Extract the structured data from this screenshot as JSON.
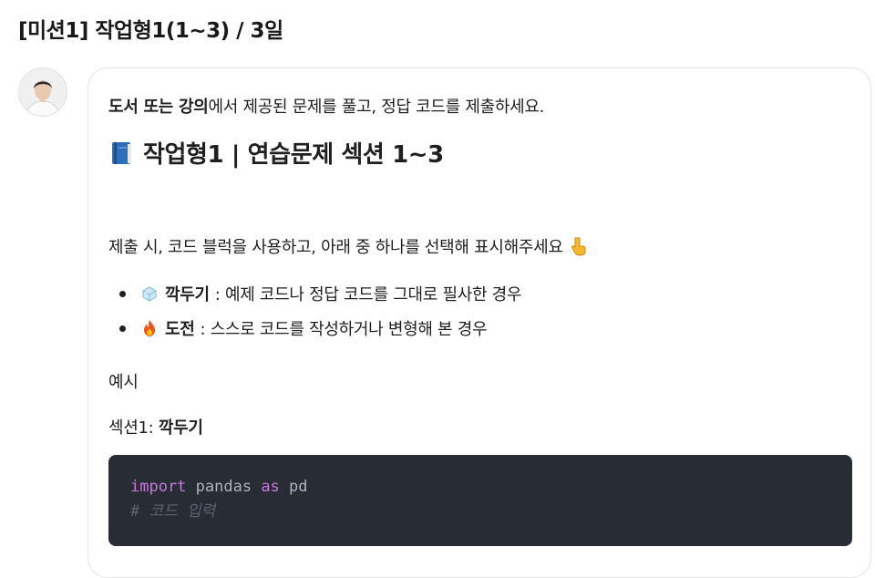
{
  "page": {
    "title": "[미션1] 작업형1(1~3) / 3일"
  },
  "post": {
    "intro_bold": "도서 또는 강의",
    "intro_rest": "에서 제공된 문제를 풀고, 정답 코드를 제출하세요.",
    "heading": "작업형1 | 연습문제 섹션 1~3",
    "heading_icon": "blue-book-icon",
    "instruction": "제출 시, 코드 블럭을 사용하고, 아래 중 하나를 선택해 표시해주세요",
    "instruction_icon": "pointing-down-hand-icon",
    "options": [
      {
        "icon": "ice-cube-icon",
        "name": "깍두기",
        "desc": ": 예제 코드나 정답 코드를 그대로 필사한 경우"
      },
      {
        "icon": "fire-icon",
        "name": "도전",
        "desc": ": 스스로 코드를 작성하거나 변형해 본 경우"
      }
    ],
    "example_label": "예시",
    "section_prefix": "섹션1: ",
    "section_value": "깍두기",
    "code": {
      "line1_keyword": "import",
      "line1_module": " pandas ",
      "line1_as": "as",
      "line1_alias": " pd",
      "line2_comment": "# 코드 입력"
    }
  },
  "colors": {
    "code_background": "#282c34",
    "keyword": "#c678dd",
    "comment": "#5c6370"
  }
}
